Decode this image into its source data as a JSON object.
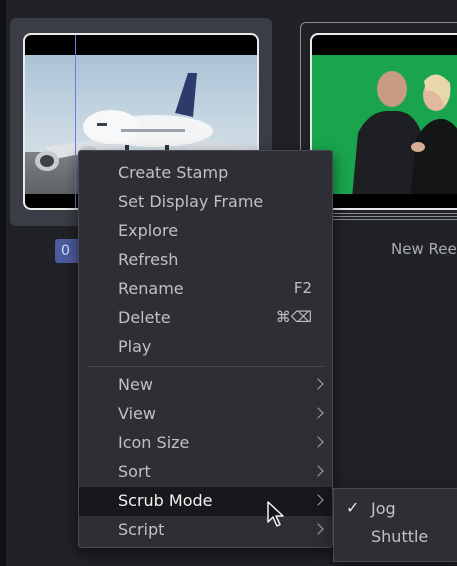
{
  "clips": [
    {
      "badge": "0",
      "name": ""
    },
    {
      "name": "New Ree"
    }
  ],
  "context_menu": {
    "items": [
      {
        "label": "Create Stamp"
      },
      {
        "label": "Set Display Frame"
      },
      {
        "label": "Explore"
      },
      {
        "label": "Refresh"
      },
      {
        "label": "Rename",
        "shortcut": "F2"
      },
      {
        "label": "Delete",
        "shortcut": "⌘⌫"
      },
      {
        "label": "Play"
      }
    ],
    "submenus": [
      {
        "label": "New"
      },
      {
        "label": "View"
      },
      {
        "label": "Icon Size"
      },
      {
        "label": "Sort"
      },
      {
        "label": "Scrub Mode",
        "highlighted": true
      },
      {
        "label": "Script"
      }
    ]
  },
  "scrub_mode_menu": {
    "items": [
      {
        "label": "Jog",
        "checked": true,
        "check_glyph": "✓"
      },
      {
        "label": "Shuttle",
        "checked": false
      }
    ]
  },
  "colors": {
    "background": "#202227",
    "menu_bg": "#2d2f35",
    "highlight_bg": "#17181b",
    "badge_bg": "#4d5a9e",
    "playhead": "#6f7ddb",
    "greenscreen": "#1aa44d"
  }
}
